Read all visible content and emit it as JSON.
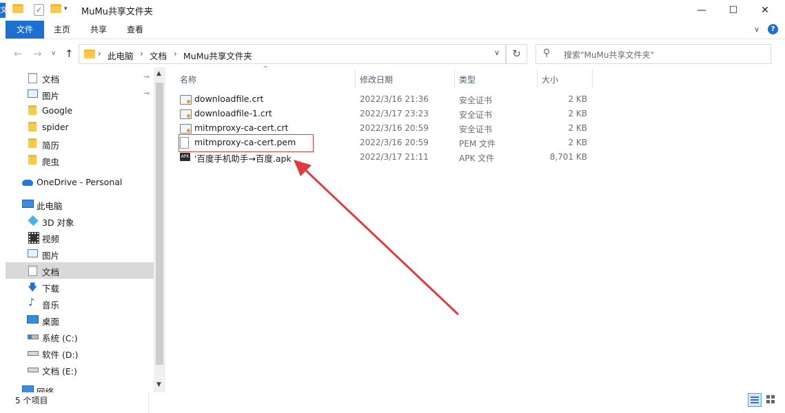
{
  "window": {
    "title": "MuMu共享文件夹",
    "edge_char": "文",
    "controls": {
      "minimize": "—",
      "maximize": "☐",
      "close": "✕"
    }
  },
  "ribbon": {
    "tabs": [
      "文件",
      "主页",
      "共享",
      "查看"
    ],
    "expand_icon": "chevron-down-icon",
    "help_label": "?"
  },
  "address": {
    "back": "←",
    "forward": "→",
    "history": "∨",
    "up": "↑",
    "crumbs": [
      "此电脑",
      "文档",
      "MuMu共享文件夹"
    ],
    "separator": "›",
    "dropdown": "∨",
    "refresh": "↻"
  },
  "search": {
    "placeholder": "搜索\"MuMu共享文件夹\"",
    "icon": "search-icon"
  },
  "sidebar": {
    "items": [
      {
        "label": "文档",
        "icon": "document-icon",
        "pinned": true
      },
      {
        "label": "图片",
        "icon": "picture-icon",
        "pinned": true
      },
      {
        "label": "Google",
        "icon": "folder-icon"
      },
      {
        "label": "spider",
        "icon": "folder-icon"
      },
      {
        "label": "简历",
        "icon": "folder-icon"
      },
      {
        "label": "爬虫",
        "icon": "folder-icon"
      },
      {
        "label": "OneDrive - Personal",
        "icon": "cloud-icon"
      },
      {
        "label": "此电脑",
        "icon": "computer-icon"
      },
      {
        "label": "3D 对象",
        "icon": "cube-icon"
      },
      {
        "label": "视频",
        "icon": "video-icon"
      },
      {
        "label": "图片",
        "icon": "picture-icon"
      },
      {
        "label": "文档",
        "icon": "document-icon",
        "selected": true
      },
      {
        "label": "下载",
        "icon": "download-icon"
      },
      {
        "label": "音乐",
        "icon": "music-icon"
      },
      {
        "label": "桌面",
        "icon": "desktop-icon"
      },
      {
        "label": "系统 (C:)",
        "icon": "drive-icon"
      },
      {
        "label": "软件 (D:)",
        "icon": "drive-icon"
      },
      {
        "label": "文档 (E:)",
        "icon": "drive-icon"
      },
      {
        "label": "网络",
        "icon": "network-icon"
      }
    ],
    "pin_glyph": "📌"
  },
  "columns": {
    "name": "名称",
    "modified": "修改日期",
    "type": "类型",
    "size": "大小",
    "sort_indicator": "^"
  },
  "files": [
    {
      "name": "downloadfile.crt",
      "modified": "2022/3/16 21:36",
      "type": "安全证书",
      "size": "2 KB",
      "icon": "certificate-icon"
    },
    {
      "name": "downloadfile-1.crt",
      "modified": "2022/3/17 23:23",
      "type": "安全证书",
      "size": "2 KB",
      "icon": "certificate-icon"
    },
    {
      "name": "mitmproxy-ca-cert.crt",
      "modified": "2022/3/16 20:59",
      "type": "安全证书",
      "size": "2 KB",
      "icon": "certificate-icon"
    },
    {
      "name": "mitmproxy-ca-cert.pem",
      "modified": "2022/3/16 20:59",
      "type": "PEM 文件",
      "size": "2 KB",
      "icon": "file-icon",
      "highlighted": true
    },
    {
      "name": "'百度手机助手→百度.apk",
      "modified": "2022/3/17 21:11",
      "type": "APK 文件",
      "size": "8,701 KB",
      "icon": "apk-icon",
      "apk_glyph": "APK"
    }
  ],
  "status": {
    "item_count": "5 个项目"
  },
  "colors": {
    "accent": "#1f6fd0",
    "annotation": "#e0393e",
    "selection": "#d9d9d9"
  }
}
